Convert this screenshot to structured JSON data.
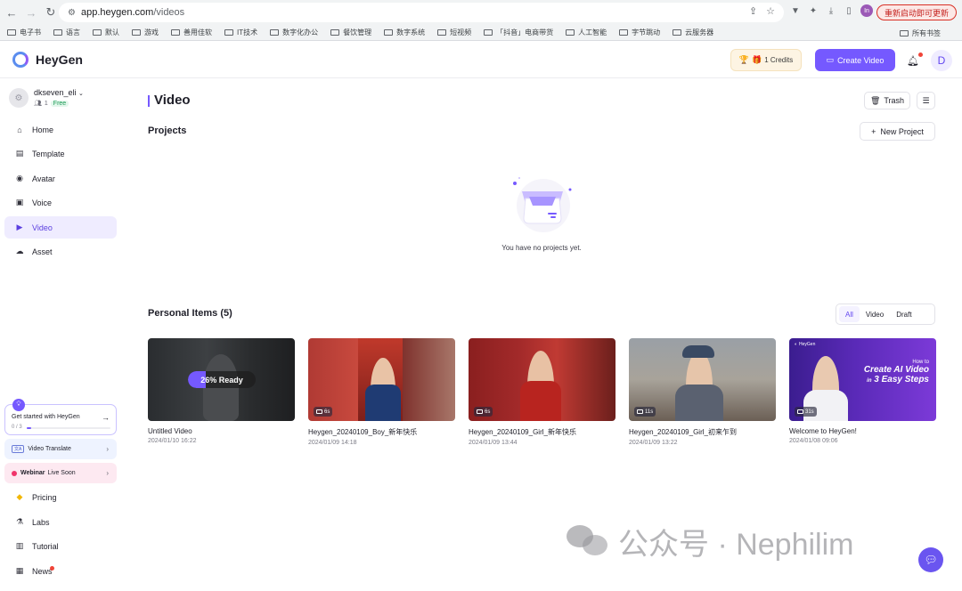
{
  "browser": {
    "url_host": "app.heygen.com",
    "url_path": "/videos",
    "restart_label": "重新启动即可更新",
    "profile_initial": "In",
    "bookmarks": [
      "电子书",
      "语言",
      "默认",
      "游戏",
      "善用佳软",
      "IT技术",
      "数字化办公",
      "餐饮管理",
      "数字系统",
      "短视频",
      "「抖音」电商带货",
      "人工智能",
      "字节跳动",
      "云服务器"
    ],
    "all_bookmarks": "所有书签"
  },
  "header": {
    "logo_text": "HeyGen",
    "credits_label": "1 Credits",
    "create_video_label": "Create Video",
    "user_initial": "D"
  },
  "sidebar": {
    "workspace_name": "dkseven_eli",
    "member_count": "1",
    "plan": "Free",
    "items": [
      {
        "label": "Home",
        "icon": "home-icon"
      },
      {
        "label": "Template",
        "icon": "template-icon"
      },
      {
        "label": "Avatar",
        "icon": "avatar-icon"
      },
      {
        "label": "Voice",
        "icon": "voice-icon"
      },
      {
        "label": "Video",
        "icon": "video-icon",
        "active": true
      },
      {
        "label": "Asset",
        "icon": "cloud-icon"
      }
    ],
    "get_started": {
      "title": "Get started with HeyGen",
      "progress_text": "0 / 3",
      "progress": 0.05
    },
    "video_translate": {
      "tag": "文A",
      "label": "Video Translate"
    },
    "webinar": {
      "bold": "Webinar",
      "label": "Live Soon"
    },
    "bottom_items": [
      {
        "label": "Pricing",
        "icon": "diamond-icon"
      },
      {
        "label": "Labs",
        "icon": "flask-icon"
      },
      {
        "label": "Tutorial",
        "icon": "book-icon"
      },
      {
        "label": "News",
        "icon": "news-icon"
      }
    ]
  },
  "main": {
    "title": "Video",
    "trash_label": "Trash",
    "projects_title": "Projects",
    "new_project_label": "New Project",
    "empty_text": "You have no projects yet.",
    "personal_title": "Personal Items (5)",
    "filters": [
      "All",
      "Video",
      "Draft"
    ],
    "active_filter": "All",
    "items": [
      {
        "title": "Untitled Video",
        "date": "2024/01/10 16:22",
        "ready": "26% Ready",
        "progress": 0.26
      },
      {
        "title": "Heygen_20240109_Boy_新年快乐",
        "date": "2024/01/09 14:18",
        "duration": "6s"
      },
      {
        "title": "Heygen_20240109_Girl_新年快乐",
        "date": "2024/01/09 13:44",
        "duration": "6s"
      },
      {
        "title": "Heygen_20240109_Girl_初来乍到",
        "date": "2024/01/09 13:22",
        "duration": "11s"
      },
      {
        "title": "Welcome to HeyGen!",
        "date": "2024/01/08 09:06",
        "duration": "31s",
        "promo_brand": "HeyGen",
        "promo_small": "How to",
        "promo_big1": "Create AI Video",
        "promo_in": "in",
        "promo_big2": "3 Easy Steps"
      }
    ]
  },
  "watermark": {
    "text": "公众号 · Nephilim"
  },
  "colors": {
    "accent": "#7559ff",
    "active_bg": "#efecff",
    "notification": "#f04438"
  }
}
